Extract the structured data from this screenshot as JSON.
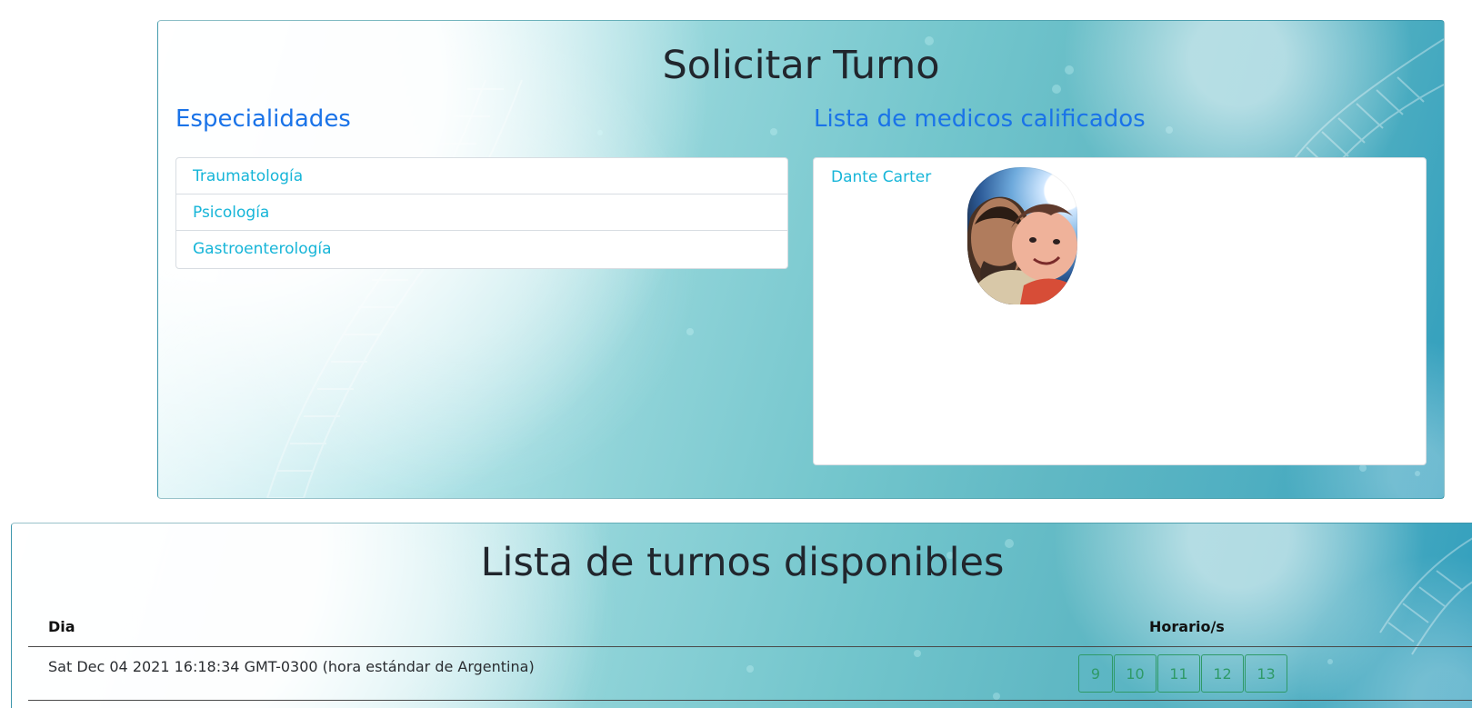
{
  "top_panel": {
    "title": "Solicitar Turno",
    "specialties_heading": "Especialidades",
    "doctors_heading": "Lista de medicos calificados",
    "specialties": [
      "Traumatología",
      "Psicología",
      "Gastroenterología"
    ],
    "doctors": [
      {
        "name": "Dante Carter"
      }
    ]
  },
  "bottom_panel": {
    "title": "Lista de turnos disponibles",
    "columns": [
      "Dia",
      "Horario/s"
    ],
    "rows": [
      {
        "date": "Sat Dec 04 2021 16:18:34 GMT-0300 (hora estándar de Argentina)",
        "hours": [
          "9",
          "10",
          "11",
          "12",
          "13"
        ]
      }
    ]
  },
  "colors": {
    "link": "#16b5d8",
    "heading_accent": "#1a73e8",
    "slot_border": "#2f9a68",
    "title_text": "#21262d"
  },
  "icons": {
    "background_decoration": "dna-helix"
  }
}
